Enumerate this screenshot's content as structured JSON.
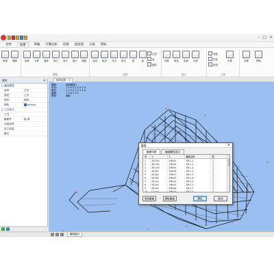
{
  "menu": [
    "文件",
    "建模",
    "荷载",
    "计算分析",
    "结果",
    "后处理",
    "工具",
    "帮助"
  ],
  "ribbon": {
    "groups": [
      "视图",
      "选择",
      "显示",
      "工具"
    ],
    "tools": [
      "新建",
      "编辑",
      "旋转",
      "平移",
      "缩放",
      "窗口",
      "放大",
      "缩小",
      "视图",
      "选择",
      "取消",
      "节点",
      "单元",
      "梁",
      "板",
      "过滤",
      "组",
      "图层",
      "线框",
      "着色",
      "剖面",
      "标签",
      "测量",
      "检查",
      "颜色",
      "列表",
      "设置",
      "帮助"
    ]
  },
  "panel": {
    "title": "属性",
    "rows": [
      {
        "k": "□ 截面属性",
        "v": "",
        "hdr": true
      },
      {
        "k": "名称",
        "v": "工字"
      },
      {
        "k": "类型",
        "v": "工字"
      },
      {
        "k": "材料",
        "v": "钢材"
      },
      {
        "k": "颜色",
        "v": "default",
        "sel": true
      },
      {
        "k": "□ 工况定义",
        "v": "",
        "hdr": true
      },
      {
        "k": "工况",
        "v": ""
      },
      {
        "k": "截面号",
        "v": "板 钢"
      },
      {
        "k": "分组名称",
        "v": ""
      },
      {
        "k": "加工信息",
        "v": ""
      },
      {
        "k": "备注",
        "v": ""
      }
    ]
  },
  "viewport": {
    "tab": "船体结构",
    "info": [
      {
        "k": "模型:",
        "v": "结构模型1"
      },
      {
        "k": "节点:",
        "v": "1 0 5 0 2 0 0 2 0"
      },
      {
        "k": "单元:",
        "v": "1 2 4 0 3 1 5 1 6"
      },
      {
        "k": "截面:",
        "v": "1 0 6 5 3 1"
      },
      {
        "k": "材料:",
        "v": "钢材"
      }
    ],
    "axes": {
      "x": "X",
      "y": "Y",
      "z": "Z"
    }
  },
  "statusbar": {
    "tab": "模型窗口"
  },
  "dialog": {
    "title": "截面",
    "tabs": [
      "截面列表",
      "截面属性定义"
    ],
    "columns": [
      "号",
      "1",
      "2",
      "截面名称",
      "型"
    ],
    "rows": [
      [
        "1",
        "A8.5x3",
        "1M0x3",
        "SM.1-1",
        "工"
      ],
      [
        "2",
        "A8.5x4",
        "1M0x4",
        "SM.1-2",
        "工"
      ],
      [
        "3",
        "A8.5x5",
        "1M0x5",
        "SM.1-3",
        "工"
      ],
      [
        "4",
        "A10x3",
        "1M0x6",
        "SM.1-4",
        "工"
      ],
      [
        "5",
        "A10x4",
        "1M0x7",
        "SM.1-5",
        "工"
      ],
      [
        "6",
        "B10x5",
        "2M0x3",
        "SM.1-6",
        "工"
      ],
      [
        "7",
        "B12x3",
        "2M0x4",
        "SM.2-1",
        "工"
      ],
      [
        "8",
        "B12x4",
        "2M0x5",
        "SM.2-2",
        "工"
      ],
      [
        "9",
        "B12x5",
        "2M0x6",
        "SM.2-3",
        "工"
      ],
      [
        "10",
        "C10x3",
        "3M0x3",
        "SM.2-4",
        "工"
      ],
      [
        "11",
        "C10x4",
        "3M0x4",
        "SM.2-5",
        "工"
      ],
      [
        "12",
        "C12x5",
        "3M0x5",
        "SM.3-1",
        "工"
      ]
    ],
    "buttons": [
      "添加截面",
      "删除截面",
      "确定",
      "取消"
    ]
  }
}
